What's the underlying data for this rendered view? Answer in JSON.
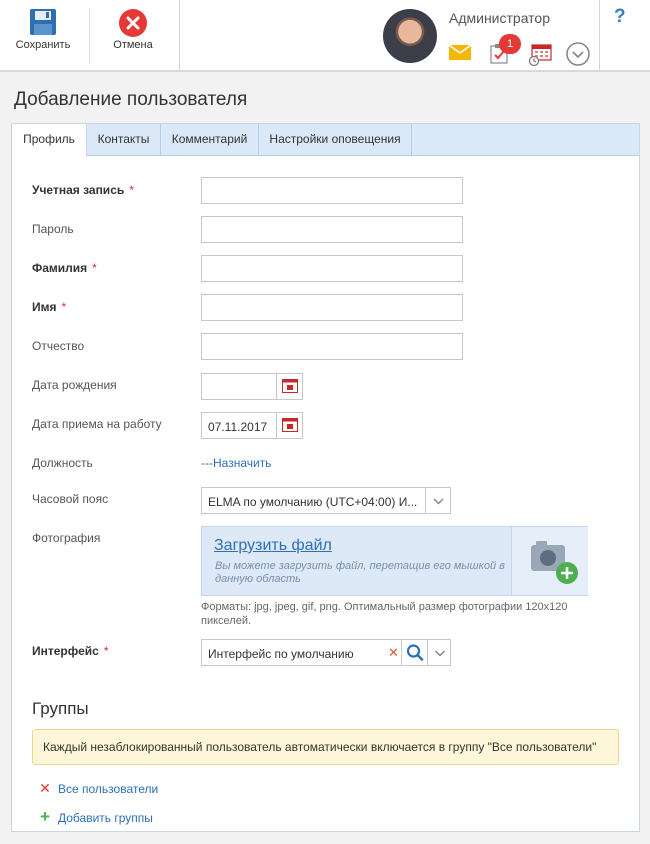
{
  "toolbar": {
    "save_label": "Сохранить",
    "cancel_label": "Отмена"
  },
  "header": {
    "username": "Администратор",
    "notifications_count": "1",
    "help": "?"
  },
  "page": {
    "title": "Добавление пользователя"
  },
  "tabs": [
    {
      "label": "Профиль",
      "active": true
    },
    {
      "label": "Контакты"
    },
    {
      "label": "Комментарий"
    },
    {
      "label": "Настройки оповещения"
    }
  ],
  "form": {
    "account": {
      "label": "Учетная запись",
      "required": "*",
      "value": ""
    },
    "password": {
      "label": "Пароль",
      "value": ""
    },
    "last_name": {
      "label": "Фамилия",
      "required": "*",
      "value": ""
    },
    "first_name": {
      "label": "Имя",
      "required": "*",
      "value": ""
    },
    "middle_name": {
      "label": "Отчество",
      "value": ""
    },
    "birth_date": {
      "label": "Дата рождения",
      "value": ""
    },
    "hire_date": {
      "label": "Дата приема на работу",
      "value": "07.11.2017"
    },
    "position": {
      "label": "Должность",
      "link": "---Назначить"
    },
    "timezone": {
      "label": "Часовой пояс",
      "value": "ELMA по умолчанию (UTC+04:00) И..."
    },
    "photo": {
      "label": "Фотография",
      "upload_link": "Загрузить файл",
      "hint": "Вы можете загрузить файл, перетащив его мышкой в данную область",
      "formats": "Форматы: jpg, jpeg, gif, png. Оптимальный размер фотографии 120x120 пикселей."
    },
    "interface": {
      "label": "Интерфейс",
      "required": "*",
      "value": "Интерфейс по умолчанию"
    }
  },
  "groups": {
    "title": "Группы",
    "notice": "Каждый незаблокированный пользователь автоматически включается в группу \"Все пользователи\"",
    "items": [
      {
        "label": "Все пользователи"
      }
    ],
    "add_label": "Добавить группы"
  },
  "colors": {
    "link": "#2e6fb7",
    "required": "#d32f2f",
    "tab_bar": "#dbe8f8",
    "notice_bg": "#fdf6d8"
  }
}
